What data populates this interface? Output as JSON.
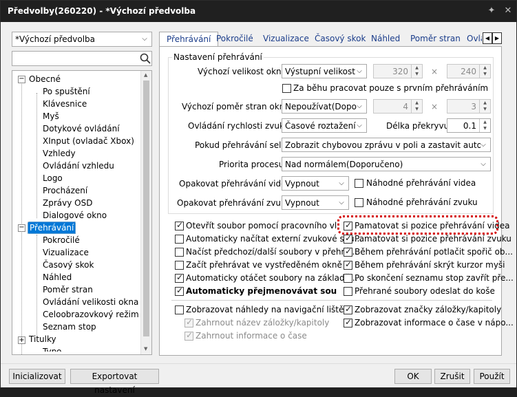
{
  "window": {
    "title": "Předvolby(260220) - *Výchozí předvolba"
  },
  "left": {
    "preset_select": "*Výchozí předvolba",
    "search_placeholder": "",
    "tree": {
      "obecne": "Obecné",
      "obecne_children": [
        "Po spuštění",
        "Klávesnice",
        "Myš",
        "Dotykové ovládání",
        "XInput (ovladač Xbox)",
        "Vzhledy",
        "Ovládání vzhledu",
        "Logo",
        "Procházení",
        "Zprávy OSD",
        "Dialogové okno"
      ],
      "prehravani": "Přehrávání",
      "prehravani_children": [
        "Pokročilé",
        "Vizualizace",
        "Časový skok",
        "Náhled",
        "Poměr stran",
        "Ovládání velikosti okna",
        "Celoobrazovkový režim",
        "Seznam stop"
      ],
      "titulky": "Titulky",
      "partial": "Typo..."
    }
  },
  "tabs": [
    "Přehrávání",
    "Pokročilé",
    "Vizualizace",
    "Časový skok",
    "Náhled",
    "Poměr stran",
    "Ovla"
  ],
  "group": {
    "title": "Nastavení přehrávání",
    "window_size": {
      "label": "Výchozí velikost okna:",
      "select": "Výstupní velikost v",
      "w": "320",
      "h": "240",
      "sep": "×"
    },
    "only_first": "Za běhu pracovat pouze s prvním přehráváním",
    "aspect": {
      "label": "Výchozí poměr stran okna:",
      "select": "Nepoužívat(Dopo",
      "w": "4",
      "h": "3",
      "sep": "×"
    },
    "audio_speed": {
      "label": "Ovládání rychlosti zvuku:",
      "select": "Časové roztažení l",
      "overlap_label": "Délka překryvu:",
      "overlap": "0.1"
    },
    "fail": {
      "label": "Pokud přehrávání selže",
      "select": "Zobrazit chybovou zprávu v poli a zastavit automatic"
    },
    "priority": {
      "label": "Priorita procesu:",
      "select": "Nad normálem(Doporučeno)"
    },
    "repeat_video": {
      "label": "Opakovat přehrávání videa:",
      "select": "Vypnout",
      "random": "Náhodné přehrávání videa"
    },
    "repeat_audio": {
      "label": "Opakovat přehrávání zvuku:",
      "select": "Vypnout",
      "random": "Náhodné přehrávání zvuku"
    }
  },
  "checks_left": [
    "Otevřít soubor pomocí pracovního vlákna",
    "Automaticky načítat externí zvukové sou...",
    "Načíst předchozí/další soubory v přehrá...",
    "Začít přehrávat ve vystředěném okně",
    "Automaticky otáčet soubory na základě...",
    "Automaticky přejmenovávat soubory na"
  ],
  "checks_right": [
    "Pamatovat si pozice přehrávání videa",
    "Pamatovat si pozice přehrávání zvuku",
    "Během přehrávání potlačit spořič ob...",
    "Během přehrávání skrýt kurzor myši",
    "Po skončení seznamu stop zavřít pře...",
    "Přehrané soubory odeslat do koše"
  ],
  "bottom_checks": {
    "thumbnails": "Zobrazovat náhledy na navigační liště",
    "chapter_name": "Zahrnout název záložky/kapitoly",
    "time_info": "Zahrnout informace o čase",
    "chapter_marks": "Zobrazovat značky záložky/kapitoly",
    "time_display": "Zobrazovat informace o čase v nápo..."
  },
  "footer": {
    "init": "Inicializovat",
    "export": "Exportovat nastavení",
    "ok": "OK",
    "cancel": "Zrušit",
    "apply": "Použít"
  },
  "colors": {
    "title_bg": "#202020",
    "selection": "#0078d7",
    "highlight_red": "#d40000"
  }
}
